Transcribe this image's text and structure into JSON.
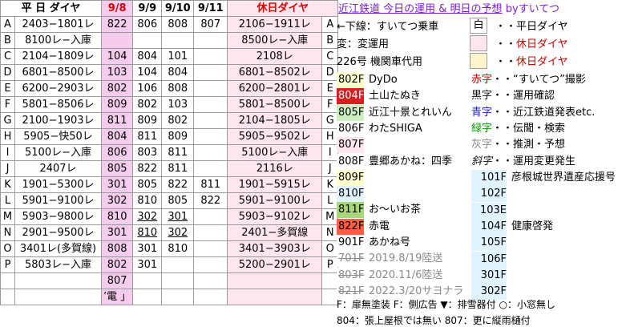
{
  "headers": [
    "平 日 ダイヤ",
    "9/8",
    "9/9",
    "9/10",
    "9/11",
    "休日ダイヤ"
  ],
  "rows": [
    {
      "l": "A",
      "wk": "2403−1801レ",
      "c": [
        "822",
        "806",
        "808",
        "807"
      ],
      "cc": [
        "g",
        "g",
        "g",
        "g"
      ],
      "hol": "2106−1911レ",
      "r": "A"
    },
    {
      "l": "B",
      "wk": "8100レ−入庫",
      "c": [
        "",
        "",
        "",
        ""
      ],
      "cc": [
        "",
        "",
        "",
        ""
      ],
      "hol": "8500レ−入庫",
      "r": "B"
    },
    {
      "l": "C",
      "wk": "2104−1809レ",
      "c": [
        "104",
        "804",
        "101",
        ""
      ],
      "cc": [
        "g",
        "g",
        "g",
        ""
      ],
      "hol": "2108レ",
      "r": "C"
    },
    {
      "l": "D",
      "wk": "6801−8500レ",
      "c": [
        "103",
        "104",
        "804",
        ""
      ],
      "cc": [
        "gy",
        "r",
        "r",
        ""
      ],
      "hol": "6801−8502レ",
      "r": "D"
    },
    {
      "l": "E",
      "wk": "6200−2903レ",
      "c": [
        "802",
        "106",
        "808",
        ""
      ],
      "cc": [
        "gy",
        "r",
        "r",
        ""
      ],
      "hol": "6200−2801レ",
      "r": "E"
    },
    {
      "l": "F",
      "wk": "5801−8506レ",
      "c": [
        "809",
        "802",
        "103",
        ""
      ],
      "cc": [
        "gy",
        "gy",
        "k",
        ""
      ],
      "hol": "5801−8500レ",
      "r": "F"
    },
    {
      "l": "G",
      "wk": "2100−1903レ",
      "c": [
        "811",
        "809",
        "802",
        ""
      ],
      "cc": [
        "gy",
        "gy",
        "k",
        ""
      ],
      "hol": "2104−1805レ",
      "r": "G"
    },
    {
      "l": "H",
      "wk": "5905−快50レ",
      "c": [
        "804",
        "811",
        "809",
        ""
      ],
      "cc": [
        "gy",
        "gy",
        "k",
        ""
      ],
      "hol": "5905−9502レ",
      "r": "H"
    },
    {
      "l": "I",
      "wk": "5100レ−入庫",
      "c": [
        "806",
        "803",
        "811",
        ""
      ],
      "cc": [
        "gy",
        "gy",
        "k",
        ""
      ],
      "hol": "5100レ−入庫",
      "r": "I"
    },
    {
      "l": "J",
      "wk": "2407レ",
      "c": [
        "805",
        "822",
        "811",
        ""
      ],
      "cc": [
        "g",
        "g",
        "g",
        ""
      ],
      "hol": "2116レ",
      "r": "J"
    },
    {
      "l": "K",
      "wk": "1901−5300レ",
      "c": [
        "301",
        "805",
        "822",
        "811"
      ],
      "cc": [
        "gy",
        "r",
        "k",
        "k"
      ],
      "hol": "1901−5915レ",
      "r": "K"
    },
    {
      "l": "L",
      "wk": "5901−9100レ",
      "c": [
        "302",
        "810",
        "805",
        "822"
      ],
      "cc": [
        "gy",
        "r",
        "r",
        "r"
      ],
      "hol": "5901−9100レ",
      "r": "L"
    },
    {
      "l": "M",
      "wk": "5903−9800レ",
      "c": [
        "810",
        "302",
        "301",
        ""
      ],
      "cc": [
        "gy",
        "r",
        "r",
        ""
      ],
      "hol": "5903−9102レ",
      "r": "M"
    },
    {
      "l": "N",
      "wk": "2901−9500レ",
      "c": [
        "301",
        "810",
        "302",
        ""
      ],
      "cc": [
        "gy",
        "k",
        "k",
        ""
      ],
      "hol": "2401−多賀線",
      "r": "N"
    },
    {
      "l": "O",
      "wk": "3401レ(多賀線)",
      "c": [
        "808",
        "301",
        "810",
        ""
      ],
      "cc": [
        "gy",
        "gy",
        "gy",
        ""
      ],
      "hol": "3401−3903レ",
      "r": "O"
    },
    {
      "l": "P",
      "wk": "5803レ−入庫",
      "c": [
        "802",
        "301",
        "",
        ""
      ],
      "cc": [
        "gy",
        "gy",
        "",
        ""
      ],
      "hol": "5200−2901レ",
      "r": "P"
    }
  ],
  "extra_row": {
    "c98": "807"
  },
  "bottom_row": {
    "c98": "’電 」"
  },
  "legend": {
    "title": "近江鉄道 今日の運用 & 明日の予想",
    "author": "byすいてつ",
    "top": [
      {
        "text": "←下線：すいてつ乗車"
      },
      {
        "text": "変：変運用"
      },
      {
        "text": "226号 機関車代用"
      }
    ],
    "mini": [
      {
        "box": "白",
        "label": "平日ダイヤ"
      },
      {
        "box": "",
        "label": "休日ダイヤ"
      },
      {
        "box": "",
        "label": "休日ダイヤ"
      }
    ],
    "cars": [
      {
        "num": "802F",
        "name": "DyDo"
      },
      {
        "num": "804F",
        "name": "土山たぬき"
      },
      {
        "num": "805F",
        "name": "近江十景とれいん"
      },
      {
        "num": "806F",
        "name": "わたSHIGA"
      },
      {
        "num": "807F",
        "name": ""
      },
      {
        "num": "808F",
        "name": "豊郷あかね：四季"
      },
      {
        "num": "809F",
        "name": ""
      },
      {
        "num": "810F",
        "name": ""
      },
      {
        "num": "811F",
        "name": "お〜いお茶"
      },
      {
        "num": "822F",
        "name": "赤電"
      },
      {
        "num": "901F",
        "name": "あかね号"
      },
      {
        "num": "701F",
        "name": "2019.8/19陸送"
      },
      {
        "num": "803F",
        "name": "2020.11/6陸送"
      },
      {
        "num": "821F",
        "name": "2022.3/20サヨナラ"
      }
    ],
    "colors": [
      {
        "key": "赤字",
        "val": "“すいてつ”撮影"
      },
      {
        "key": "黒字",
        "val": "運用確認"
      },
      {
        "key": "青字",
        "val": "近江鉄道発表etc."
      },
      {
        "key": "緑字",
        "val": "伝聞・検索"
      },
      {
        "key": "灰字",
        "val": "推測・予想"
      },
      {
        "key": "斜字",
        "val": "運用変更発生"
      }
    ],
    "locos": [
      {
        "num": "101F",
        "name": "彦根城世界遺産応援号"
      },
      {
        "num": "102F",
        "name": ""
      },
      {
        "num": "103E",
        "name": ""
      },
      {
        "num": "104F",
        "name": "健康啓発"
      },
      {
        "num": "105F",
        "name": ""
      },
      {
        "num": "106F",
        "name": ""
      },
      {
        "num": "301F",
        "name": ""
      },
      {
        "num": "302F",
        "name": ""
      }
    ],
    "notes1": "F：扉無塗装 F：側広告 ▼：排雪器付 ○：小窓無し",
    "notes2": "804：張上屋根では無い 807：更に縦雨樋付"
  }
}
